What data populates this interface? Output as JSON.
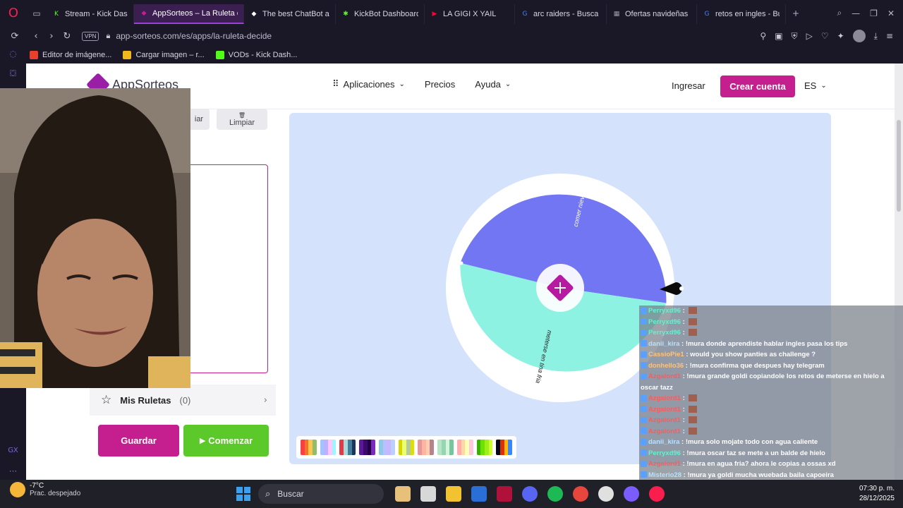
{
  "browser": {
    "tabs": [
      {
        "label": "Stream - Kick Dash",
        "color": "#53fc18",
        "glyph": "K",
        "active": false,
        "width": 124
      },
      {
        "label": "AppSorteos – La Ruleta d",
        "color": "#c51f8f",
        "glyph": "◆",
        "active": true,
        "width": 156
      },
      {
        "label": "The best ChatBot a",
        "color": "#ffffff",
        "glyph": "◆",
        "active": false,
        "width": 130
      },
      {
        "label": "KickBot Dashboard",
        "color": "#53fc18",
        "glyph": "✱",
        "active": false,
        "width": 126
      },
      {
        "label": "LA GIGI X YAIL",
        "color": "#ff0033",
        "glyph": "▶",
        "active": false,
        "width": 128
      },
      {
        "label": "arc raiders - Busca",
        "color": "#4285f4",
        "glyph": "G",
        "active": false,
        "width": 130
      },
      {
        "label": "Ofertas navideñas",
        "color": "#9a9aa8",
        "glyph": "▦",
        "active": false,
        "width": 128
      },
      {
        "label": "retos en ingles - Bu",
        "color": "#4285f4",
        "glyph": "G",
        "active": false,
        "width": 126
      }
    ],
    "vpn": "VPN",
    "url": "app-sorteos.com/es/apps/la-ruleta-decide",
    "bookmarks": [
      {
        "label": "Editor de imágene...",
        "color": "#e8402a"
      },
      {
        "label": "Cargar imagen – r...",
        "color": "#f0b81c"
      },
      {
        "label": "VODs - Kick Dash...",
        "color": "#53fc18"
      }
    ]
  },
  "site": {
    "logo": "AppSorteos",
    "nav": {
      "apps": "Aplicaciones",
      "prices": "Precios",
      "help": "Ayuda"
    },
    "login": "Ingresar",
    "signup": "Crear cuenta",
    "lang": "ES",
    "toolbar": {
      "clear_partial": "iar",
      "clear": "Limpiar"
    },
    "mis_ruletas": {
      "title": "Mis Ruletas",
      "count": "(0)"
    },
    "save": "Guardar",
    "start": "Comenzar"
  },
  "wheel": {
    "segments": [
      {
        "label": "comer nieve",
        "color": "#7376f2"
      },
      {
        "label": "meterse en tina fria",
        "color": "#8ef2e3"
      }
    ]
  },
  "palette": [
    [
      "#f94144",
      "#f3722c",
      "#f9c74f",
      "#90be6d"
    ],
    [
      "#a0c4ff",
      "#bdb2ff",
      "#ffc6ff",
      "#9bf6ff"
    ],
    [
      "#e63946",
      "#a8dadc",
      "#457b9d",
      "#1d3557"
    ],
    [
      "#5a189a",
      "#3c096c",
      "#240046",
      "#7b2cbf"
    ],
    [
      "#8ecae6",
      "#b8c0ff",
      "#c8b6ff",
      "#bbd0ff"
    ],
    [
      "#d4d700",
      "#e9ff70",
      "#b5c99a",
      "#dddf00"
    ],
    [
      "#e5989b",
      "#ffb4a2",
      "#ffcdb2",
      "#b5838d"
    ],
    [
      "#b7e4c7",
      "#95d5b2",
      "#d8f3dc",
      "#74c69d"
    ],
    [
      "#ffadad",
      "#ffd6a5",
      "#fdffb6",
      "#ffc8dd"
    ],
    [
      "#38b000",
      "#70e000",
      "#9ef01a",
      "#ccff33"
    ],
    [
      "#03071e",
      "#dc2f02",
      "#ffba08",
      "#3a86ff"
    ]
  ],
  "chat": [
    {
      "user": "Perryxd96",
      "cls": "teal",
      "msg": "",
      "emote": true
    },
    {
      "user": "Perryxd96",
      "cls": "teal",
      "msg": "",
      "emote": true
    },
    {
      "user": "Perryxd96",
      "cls": "teal",
      "msg": "",
      "emote": true
    },
    {
      "user": "danii_kira",
      "cls": "",
      "msg": "!mura donde aprendiste hablar ingles pasa los tips",
      "emote": false
    },
    {
      "user": "CassioPie1",
      "cls": "orange",
      "msg": "would you show panties as challenge ?",
      "emote": false
    },
    {
      "user": "donhello36",
      "cls": "orange",
      "msg": "!mura confirma que despues hay telegram",
      "emote": false
    },
    {
      "user": "Azgalord1",
      "cls": "red",
      "msg": "!mura grande goldi copiandole los retos de meterse en hielo a",
      "emote": false
    },
    {
      "user": "",
      "cls": "",
      "msg": "oscar tazz",
      "emote": false
    },
    {
      "user": "Azgalord1",
      "cls": "red",
      "msg": "",
      "emote": true
    },
    {
      "user": "Azgalord1",
      "cls": "red",
      "msg": "",
      "emote": true
    },
    {
      "user": "Azgalord1",
      "cls": "red",
      "msg": "",
      "emote": true
    },
    {
      "user": "Azgalord1",
      "cls": "red",
      "msg": "",
      "emote": true
    },
    {
      "user": "danii_kira",
      "cls": "",
      "msg": "!mura solo mojate todo con agua caliente",
      "emote": false
    },
    {
      "user": "Perryxd96",
      "cls": "teal",
      "msg": "!mura oscar taz se mete a un balde de hielo",
      "emote": false
    },
    {
      "user": "Azgalord1",
      "cls": "red",
      "msg": "!mura en agua fria? ahora le copias a ossas xd",
      "emote": false
    },
    {
      "user": "Misterio28",
      "cls": "",
      "msg": "!mura ya goldi mucha wuebada baila capoeira",
      "emote": false
    }
  ],
  "taskbar": {
    "temp": "-7°C",
    "weather": "Prac. despejado",
    "search": "Buscar",
    "time": "07:30 p. m.",
    "date": "28/12/2025"
  }
}
